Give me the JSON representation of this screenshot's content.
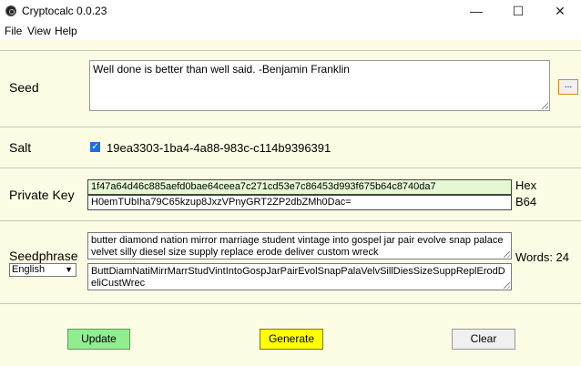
{
  "window": {
    "title": "Cryptocalc 0.0.23",
    "minimize": "—",
    "maximize": "☐",
    "close": "✕"
  },
  "menu": {
    "file": "File",
    "view": "View",
    "help": "Help"
  },
  "seed": {
    "label": "Seed",
    "value": "Well done is better than well said. -Benjamin Franklin",
    "browse_label": "..."
  },
  "salt": {
    "label": "Salt",
    "checked": true,
    "value": "19ea3303-1ba4-4a88-983c-c114b9396391"
  },
  "private_key": {
    "label": "Private Key",
    "hex_value": "1f47a64d46c885aefd0bae64ceea7c271cd53e7c86453d993f675b64c8740da7",
    "hex_label": "Hex",
    "b64_value": "H0emTUbIha79C65kzup8JxzVPnyGRT2ZP2dbZMh0Dac=",
    "b64_label": "B64"
  },
  "seedphrase": {
    "label": "Seedphrase",
    "language": "English",
    "words": "butter diamond nation mirror marriage student vintage into gospel jar pair evolve snap palace velvet silly diesel size supply replace erode deliver custom wreck",
    "short": "ButtDiamNatiMirrMarrStudVintIntoGospJarPairEvolSnapPalaVelvSillDiesSizeSuppReplErodDeliCustWrec",
    "word_count": "Words: 24"
  },
  "buttons": {
    "update": "Update",
    "generate": "Generate",
    "clear": "Clear"
  },
  "colors": {
    "background": "#fcfce4",
    "hex_field_bg": "#e6f7d4",
    "update_bg": "#90ee90",
    "generate_bg": "#ffff00",
    "clear_bg": "#f0f0f0"
  }
}
